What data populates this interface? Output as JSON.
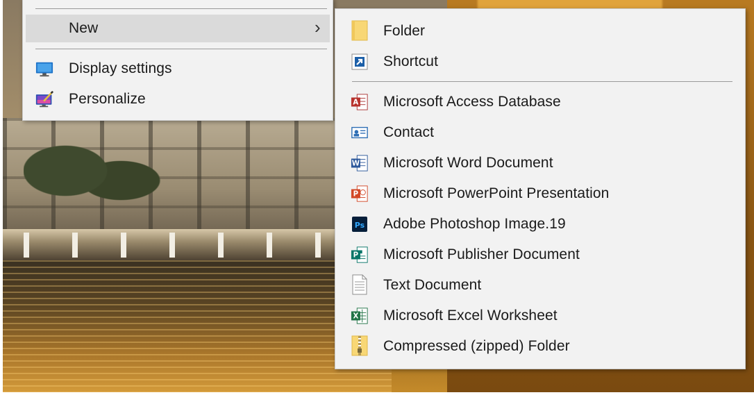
{
  "main_menu": {
    "new_label": "New",
    "display_settings_label": "Display settings",
    "personalize_label": "Personalize"
  },
  "submenu": {
    "items": [
      {
        "label": "Folder",
        "icon": "folder-icon"
      },
      {
        "label": "Shortcut",
        "icon": "shortcut-icon"
      },
      {
        "label": "Microsoft Access Database",
        "icon": "access-icon"
      },
      {
        "label": "Contact",
        "icon": "contact-icon"
      },
      {
        "label": "Microsoft Word Document",
        "icon": "word-icon"
      },
      {
        "label": "Microsoft PowerPoint Presentation",
        "icon": "powerpoint-icon"
      },
      {
        "label": "Adobe Photoshop Image.19",
        "icon": "photoshop-icon"
      },
      {
        "label": "Microsoft Publisher Document",
        "icon": "publisher-icon"
      },
      {
        "label": "Text Document",
        "icon": "text-document-icon"
      },
      {
        "label": "Microsoft Excel Worksheet",
        "icon": "excel-icon"
      },
      {
        "label": "Compressed (zipped) Folder",
        "icon": "zip-folder-icon"
      }
    ]
  },
  "colors": {
    "menu_bg": "#f2f2f2",
    "highlight": "#dadada",
    "access": "#c0392b",
    "word": "#2b579a",
    "powerpoint": "#d24726",
    "photoshop": "#001d34",
    "publisher": "#077568",
    "excel": "#217346",
    "folder": "#f8d775"
  }
}
